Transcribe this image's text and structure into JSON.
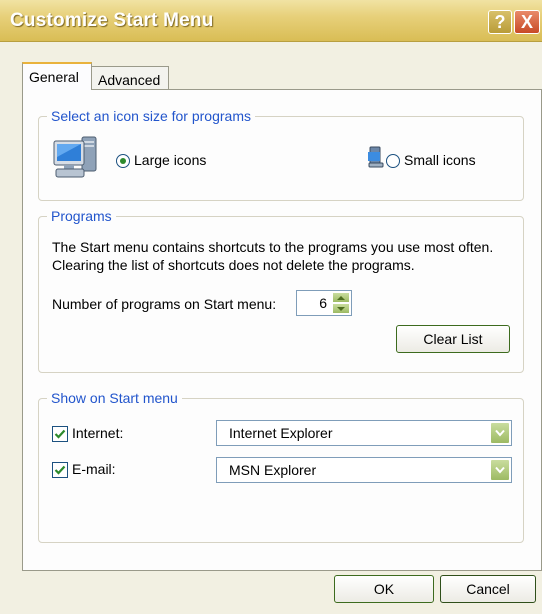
{
  "window": {
    "title": "Customize Start Menu",
    "help_label": "?",
    "close_label": "X"
  },
  "tabs": [
    {
      "label": "General",
      "selected": true
    },
    {
      "label": "Advanced",
      "selected": false
    }
  ],
  "icon_size_group": {
    "legend": "Select an icon size for programs",
    "large_label": "Large icons",
    "small_label": "Small icons",
    "selected": "Large icons"
  },
  "programs_group": {
    "legend": "Programs",
    "description": "The Start menu contains shortcuts to the programs you use most often. Clearing the list of shortcuts does not delete the programs.",
    "number_label": "Number of programs on Start menu:",
    "number_value": "6",
    "clear_label": "Clear List"
  },
  "show_group": {
    "legend": "Show on Start menu",
    "internet": {
      "label": "Internet:",
      "checked": true,
      "value": "Internet Explorer"
    },
    "email": {
      "label": "E-mail:",
      "checked": true,
      "value": "MSN Explorer"
    }
  },
  "buttons": {
    "ok_label": "OK",
    "cancel_label": "Cancel"
  },
  "colors": {
    "titlebar": "#e7d07a",
    "legend_text": "#2255cc",
    "accent_green": "#9dba63"
  }
}
